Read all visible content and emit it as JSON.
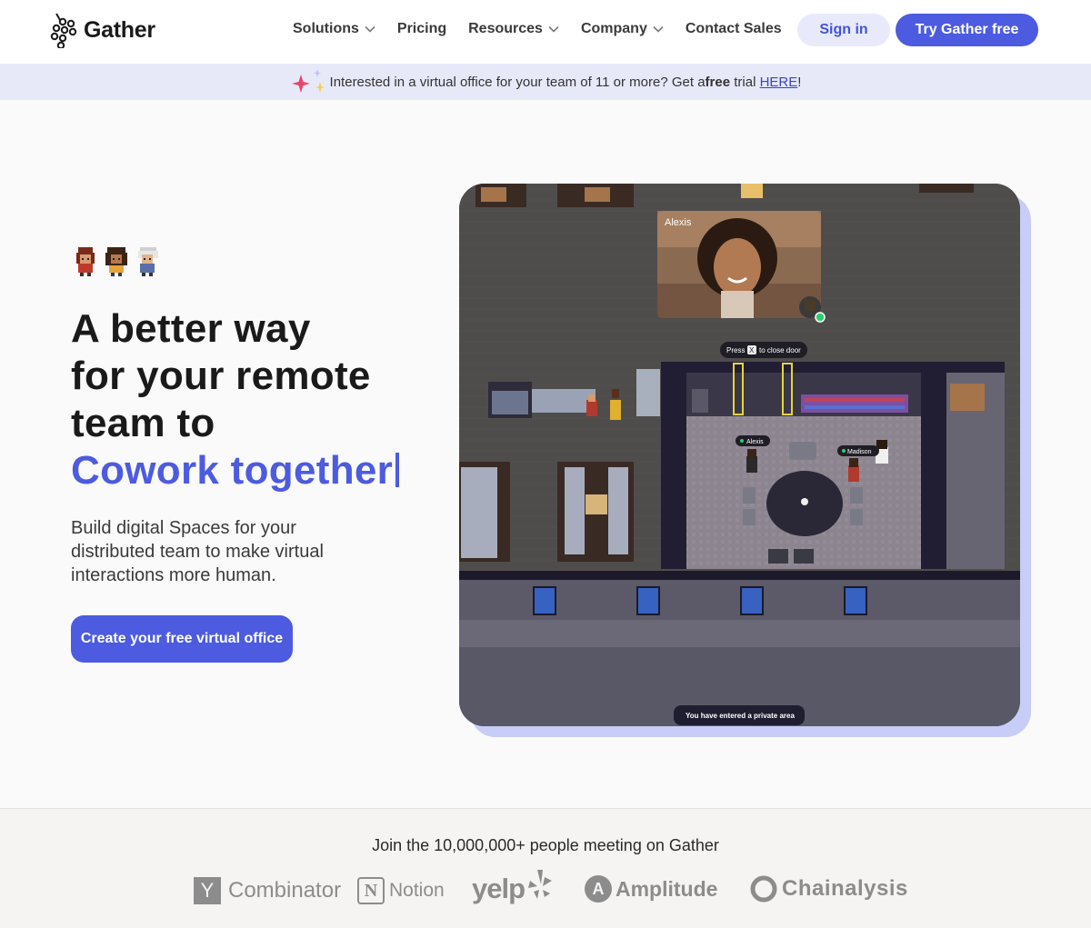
{
  "nav": {
    "brand": "Gather",
    "links": [
      {
        "label": "Solutions",
        "dropdown": true
      },
      {
        "label": "Pricing",
        "dropdown": false
      },
      {
        "label": "Resources",
        "dropdown": true
      },
      {
        "label": "Company",
        "dropdown": true
      },
      {
        "label": "Contact Sales",
        "dropdown": false
      }
    ],
    "signin": "Sign in",
    "try": "Try Gather free"
  },
  "banner": {
    "pre": "Interested in a virtual office for your team of 11 or more? Get a ",
    "bold": "free",
    "mid": " trial ",
    "link": "HERE",
    "post": "!"
  },
  "hero": {
    "line1": "A better way",
    "line2": "for your remote",
    "line3": "team to",
    "accent": "Cowork together",
    "subtitle": "Build digital Spaces for your distributed team to make virtual interactions more human.",
    "cta": "Create your free virtual office"
  },
  "game": {
    "video_name": "Alexis",
    "press_hint_pre": "Press",
    "press_key": "X",
    "press_hint_post": "to close door",
    "player1": "Alexis",
    "player2": "Madison",
    "toast": "You have entered a private area"
  },
  "social": {
    "title": "Join the 10,000,000+ people meeting on Gather",
    "logos": [
      "Combinator",
      "Notion",
      "yelp",
      "Amplitude",
      "Chainalysis"
    ],
    "yc_mark": "Y",
    "notion_mark": "N",
    "amplitude_mark": "A"
  },
  "colors": {
    "brand": "#4c5be0",
    "banner_bg": "#e7e9f9",
    "signin_bg": "#e8eafc"
  }
}
